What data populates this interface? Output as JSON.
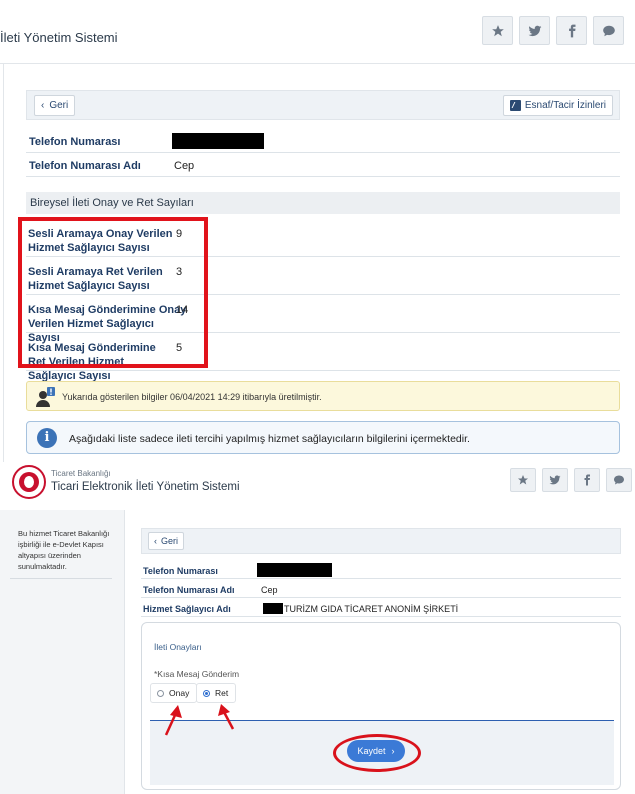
{
  "panel1": {
    "header": {
      "title": "İleti Yönetim Sistemi"
    },
    "toolbar": {
      "back_label": "Geri",
      "izin_label": "Esnaf/Tacir İzinleri"
    },
    "phone_number_label": "Telefon Numarası",
    "phone_name_label": "Telefon Numarası Adı",
    "phone_name_value": "Cep",
    "section_title": "Bireysel İleti Onay ve Ret Sayıları",
    "stats": [
      {
        "label": "Sesli Aramaya Onay Verilen Hizmet Sağlayıcı Sayısı",
        "value": "9"
      },
      {
        "label": "Sesli Aramaya Ret Verilen Hizmet Sağlayıcı Sayısı",
        "value": "3"
      },
      {
        "label": "Kısa Mesaj Gönderimine Onay Verilen Hizmet Sağlayıcı Sayısı",
        "value": "14"
      },
      {
        "label": "Kısa Mesaj Gönderimine Ret Verilen Hizmet Sağlayıcı Sayısı",
        "value": "5"
      }
    ],
    "notice_yellow": "Yukarıda gösterilen bilgiler 06/04/2021 14:29 itibarıyla üretilmiştir.",
    "notice_blue": "Aşağıdaki liste sadece ileti tercihi yapılmış hizmet sağlayıcıların bilgilerini içermektedir."
  },
  "panel2": {
    "ministry": "Ticaret Bakanlığı",
    "title": "Ticari Elektronik İleti Yönetim Sistemi",
    "sidebar_text": "Bu hizmet Ticaret Bakanlığı işbirliği ile e-Devlet Kapısı altyapısı üzerinden sunulmaktadır.",
    "back_label": "Geri",
    "phone_number_label": "Telefon Numarası",
    "phone_name_label": "Telefon Numarası Adı",
    "phone_name_value": "Cep",
    "provider_label": "Hizmet Sağlayıcı Adı",
    "provider_value": "TURİZM GIDA TİCARET ANONİM ŞİRKETİ",
    "card_title": "İleti Onayları",
    "channel_label": "*Kısa Mesaj Gönderim",
    "radio_onay": "Onay",
    "radio_ret": "Ret",
    "selected": "Ret",
    "save_label": "Kaydet"
  },
  "icons": [
    "star-icon",
    "twitter-icon",
    "facebook-icon",
    "comment-icon",
    "info-icon",
    "user-alert-icon",
    "chevron-left-icon",
    "chevron-right-icon",
    "edit-icon",
    "ministry-seal"
  ],
  "colors": {
    "highlight_red": "#e1131b",
    "primary_blue": "#3b7ad6",
    "label_navy": "#1f3c64"
  }
}
